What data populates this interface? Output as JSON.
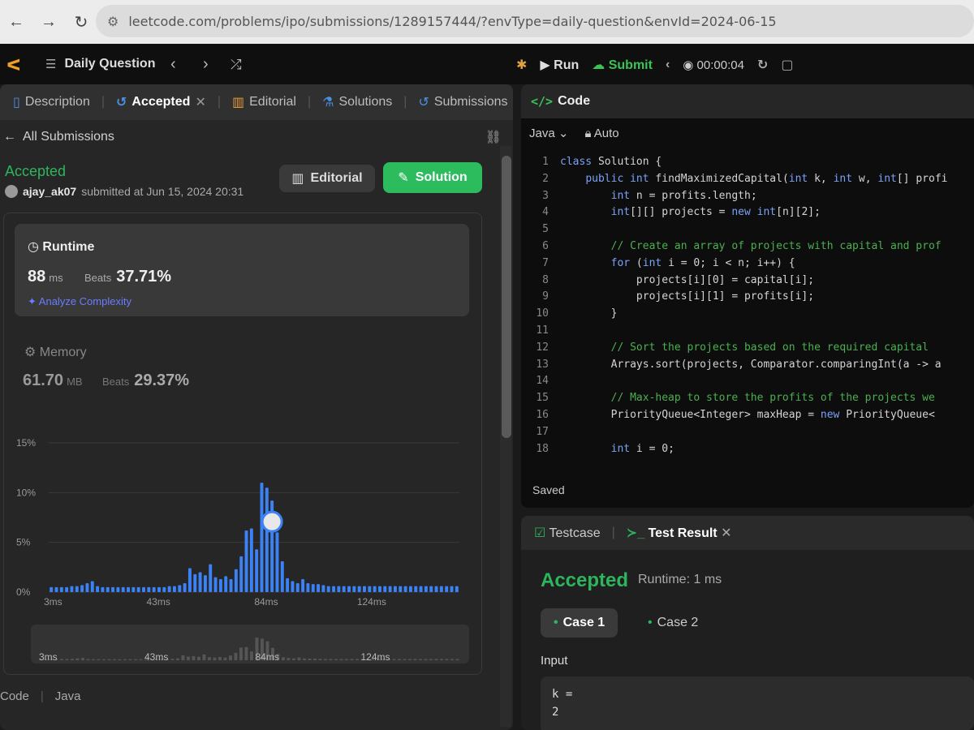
{
  "browser": {
    "url": "leetcode.com/problems/ipo/submissions/1289157444/?envType=daily-question&envId=2024-06-15"
  },
  "topbar": {
    "daily_question": "Daily Question",
    "run": "Run",
    "submit": "Submit",
    "timer": "00:00:04"
  },
  "left": {
    "tabs": [
      "Description",
      "Accepted",
      "Editorial",
      "Solutions",
      "Submissions"
    ],
    "all_submissions": "All Submissions",
    "status": "Accepted",
    "user": "ajay_ak07",
    "submitted_text": "submitted at Jun 15, 2024 20:31",
    "editorial_btn": "Editorial",
    "solution_btn": "Solution",
    "runtime_label": "Runtime",
    "runtime_value": "88",
    "runtime_unit": "ms",
    "beats_label": "Beats",
    "runtime_beats": "37.71%",
    "analyze": "Analyze Complexity",
    "memory_label": "Memory",
    "memory_value": "61.70",
    "memory_unit": "MB",
    "memory_beats": "29.37%",
    "footer_code": "Code",
    "footer_lang": "Java"
  },
  "chart_data": {
    "type": "bar",
    "y_ticks": [
      "15%",
      "10%",
      "5%",
      "0%"
    ],
    "x_ticks": [
      "3ms",
      "43ms",
      "84ms",
      "124ms"
    ],
    "ylim": [
      0,
      15
    ],
    "values": [
      0.5,
      0.5,
      0.5,
      0.5,
      0.6,
      0.6,
      0.7,
      0.9,
      1.1,
      0.6,
      0.5,
      0.5,
      0.5,
      0.5,
      0.5,
      0.5,
      0.5,
      0.5,
      0.5,
      0.5,
      0.5,
      0.5,
      0.5,
      0.6,
      0.6,
      0.7,
      0.9,
      2.4,
      1.8,
      2.0,
      1.7,
      2.8,
      1.5,
      1.3,
      1.6,
      1.3,
      2.3,
      3.6,
      6.2,
      6.4,
      4.3,
      11.0,
      10.5,
      9.2,
      6.0,
      3.1,
      1.4,
      1.1,
      0.9,
      1.3,
      0.9,
      0.8,
      0.8,
      0.7,
      0.6,
      0.6,
      0.6,
      0.6,
      0.6,
      0.6,
      0.6,
      0.6,
      0.6,
      0.6,
      0.6,
      0.6,
      0.6,
      0.6,
      0.6,
      0.6,
      0.6,
      0.6,
      0.6,
      0.6,
      0.6,
      0.6,
      0.6,
      0.6,
      0.6,
      0.6
    ],
    "highlight_index": 43,
    "bar_color": "#3b82f6",
    "mini_labels": [
      "3ms",
      "43ms",
      "84ms",
      "124ms"
    ]
  },
  "code": {
    "title": "Code",
    "language": "Java",
    "mode": "Auto",
    "lines": [
      "class Solution {",
      "    public int findMaximizedCapital(int k, int w, int[] profi",
      "        int n = profits.length;",
      "        int[][] projects = new int[n][2];",
      "",
      "        // Create an array of projects with capital and prof",
      "        for (int i = 0; i < n; i++) {",
      "            projects[i][0] = capital[i];",
      "            projects[i][1] = profits[i];",
      "        }",
      "",
      "        // Sort the projects based on the required capital",
      "        Arrays.sort(projects, Comparator.comparingInt(a -> a",
      "",
      "        // Max-heap to store the profits of the projects we",
      "        PriorityQueue<Integer> maxHeap = new PriorityQueue<",
      "",
      "        int i = 0;"
    ],
    "saved": "Saved"
  },
  "result": {
    "testcase_tab": "Testcase",
    "test_result_tab": "Test Result",
    "status": "Accepted",
    "runtime": "Runtime: 1 ms",
    "case1": "Case 1",
    "case2": "Case 2",
    "input_label": "Input",
    "input_line1": "k =",
    "input_line2": "2"
  }
}
